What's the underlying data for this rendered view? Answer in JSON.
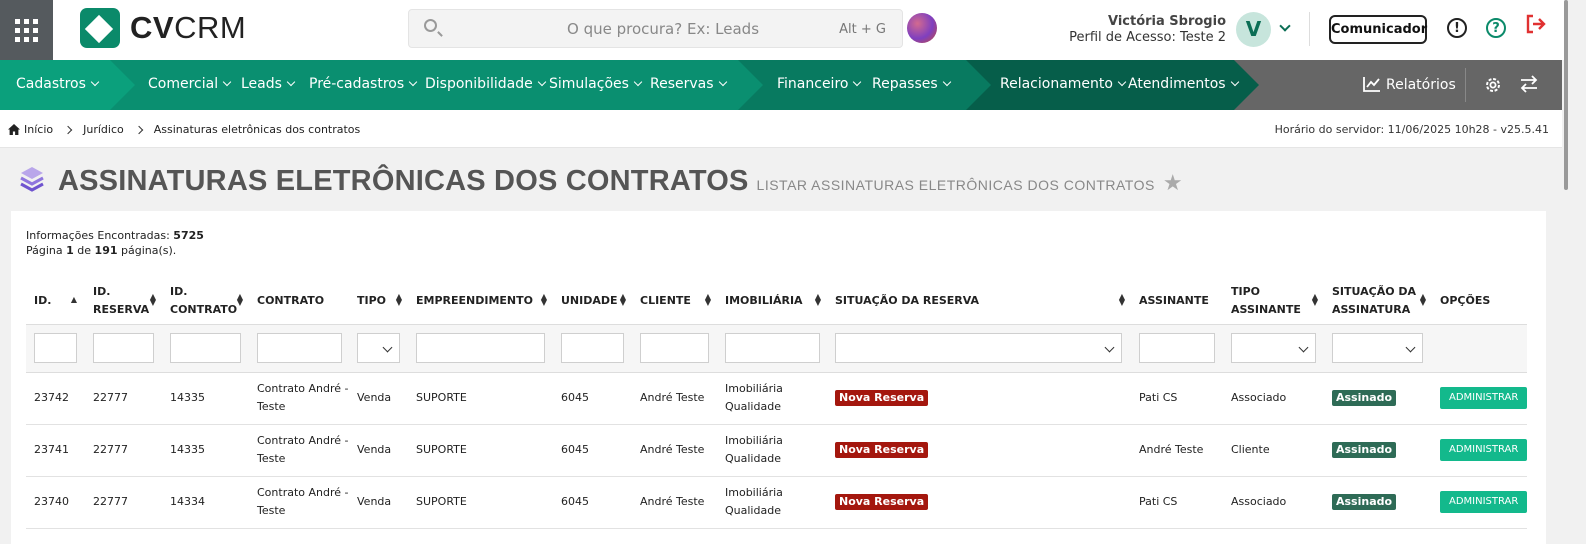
{
  "header": {
    "logo_bold": "CV",
    "logo_light": "CRM",
    "search_placeholder": "O que procura? Ex: Leads",
    "search_shortcut": "Alt + G",
    "user_name": "Victória Sbrogio",
    "user_profile": "Perfil de Acesso: Teste 2",
    "avatar_letter": "V",
    "communicator_label": "Comunicador"
  },
  "nav": {
    "items": [
      "Cadastros",
      "Comercial",
      "Leads",
      "Pré-cadastros",
      "Disponibilidade",
      "Simulações",
      "Reservas",
      "Financeiro",
      "Repasses",
      "Relacionamento",
      "Atendimentos"
    ],
    "reports_label": "Relatórios"
  },
  "breadcrumb": {
    "items": [
      "Início",
      "Jurídico",
      "Assinaturas eletrônicas dos contratos"
    ],
    "server_time": "Horário do servidor: 11/06/2025 10h28 - v25.5.41"
  },
  "page": {
    "title": "ASSINATURAS ELETRÔNICAS DOS CONTRATOS",
    "subtitle": "LISTAR ASSINATURAS ELETRÔNICAS DOS CONTRATOS"
  },
  "summary": {
    "found_label": "Informações Encontradas:",
    "found_count": "5725",
    "page_prefix": "Página",
    "page_current": "1",
    "page_of": "de",
    "page_total": "191",
    "page_suffix": "página(s)."
  },
  "table": {
    "columns": [
      "ID.",
      "ID. RESERVA",
      "ID. CONTRATO",
      "CONTRATO",
      "TIPO",
      "EMPREENDIMENTO",
      "UNIDADE",
      "CLIENTE",
      "IMOBILIÁRIA",
      "SITUAÇÃO DA RESERVA",
      "ASSINANTE",
      "TIPO ASSINANTE",
      "SITUAÇÃO DA ASSINATURA",
      "OPÇÕES"
    ],
    "rows": [
      {
        "id": "23742",
        "reserva": "22777",
        "contrato_id": "14335",
        "contrato": "Contrato André - Teste",
        "tipo": "Venda",
        "empreendimento": "SUPORTE",
        "unidade": "6045",
        "cliente": "André Teste",
        "imobiliaria": "Imobiliária Qualidade",
        "situacao_reserva": "Nova Reserva",
        "assinante": "Pati CS",
        "tipo_assinante": "Associado",
        "situacao_assinatura": "Assinado",
        "opcao": "ADMINISTRAR"
      },
      {
        "id": "23741",
        "reserva": "22777",
        "contrato_id": "14335",
        "contrato": "Contrato André - Teste",
        "tipo": "Venda",
        "empreendimento": "SUPORTE",
        "unidade": "6045",
        "cliente": "André Teste",
        "imobiliaria": "Imobiliária Qualidade",
        "situacao_reserva": "Nova Reserva",
        "assinante": "André Teste",
        "tipo_assinante": "Cliente",
        "situacao_assinatura": "Assinado",
        "opcao": "ADMINISTRAR"
      },
      {
        "id": "23740",
        "reserva": "22777",
        "contrato_id": "14334",
        "contrato": "Contrato André - Teste",
        "tipo": "Venda",
        "empreendimento": "SUPORTE",
        "unidade": "6045",
        "cliente": "André Teste",
        "imobiliaria": "Imobiliária Qualidade",
        "situacao_reserva": "Nova Reserva",
        "assinante": "Pati CS",
        "tipo_assinante": "Associado",
        "situacao_assinatura": "Assinado",
        "opcao": "ADMINISTRAR"
      }
    ]
  },
  "colors": {
    "brand": "#0b8a6a",
    "reserva_badge": "#a4170e",
    "assinado_badge": "#2e6b56",
    "admin_button": "#13b98c"
  }
}
